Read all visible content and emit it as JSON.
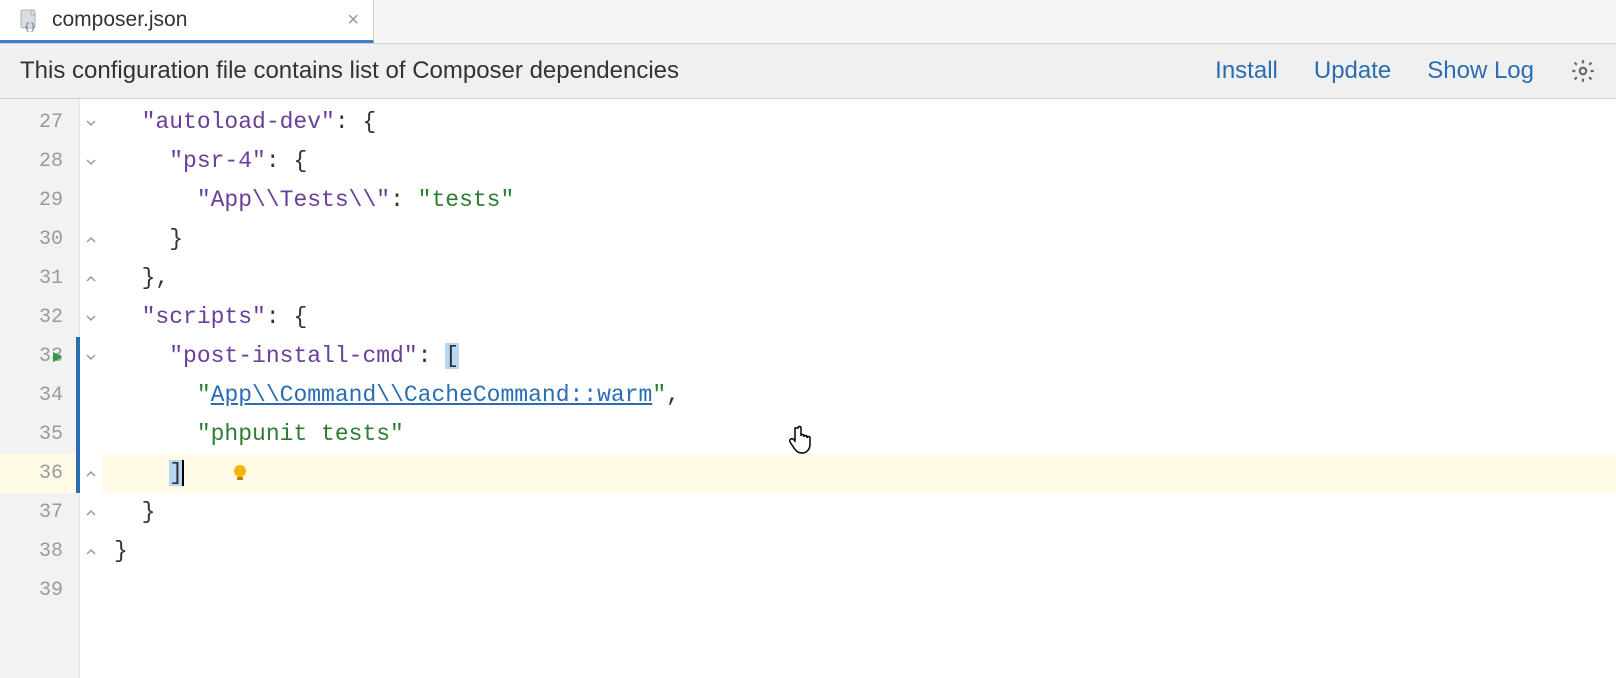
{
  "tab": {
    "title": "composer.json"
  },
  "notice": {
    "text": "This configuration file contains list of Composer dependencies",
    "install": "Install",
    "update": "Update",
    "showlog": "Show Log"
  },
  "lines": [
    {
      "num": 27,
      "tokens": [
        [
          "plain",
          "  "
        ],
        [
          "key",
          "\"autoload-dev\""
        ],
        [
          "punc",
          ": {"
        ]
      ]
    },
    {
      "num": 28,
      "tokens": [
        [
          "plain",
          "    "
        ],
        [
          "key",
          "\"psr-4\""
        ],
        [
          "punc",
          ": {"
        ]
      ]
    },
    {
      "num": 29,
      "tokens": [
        [
          "plain",
          "      "
        ],
        [
          "key",
          "\"App\\\\Tests\\\\\""
        ],
        [
          "punc",
          ": "
        ],
        [
          "str",
          "\"tests\""
        ]
      ]
    },
    {
      "num": 30,
      "tokens": [
        [
          "plain",
          "    "
        ],
        [
          "punc",
          "}"
        ]
      ]
    },
    {
      "num": 31,
      "tokens": [
        [
          "plain",
          "  "
        ],
        [
          "punc",
          "},"
        ]
      ]
    },
    {
      "num": 32,
      "tokens": [
        [
          "plain",
          "  "
        ],
        [
          "key",
          "\"scripts\""
        ],
        [
          "punc",
          ": {"
        ]
      ]
    },
    {
      "num": 33,
      "tokens": [
        [
          "plain",
          "    "
        ],
        [
          "key",
          "\"post-install-cmd\""
        ],
        [
          "punc",
          ": "
        ],
        [
          "sel",
          "["
        ]
      ],
      "run": true,
      "change": true
    },
    {
      "num": 34,
      "tokens": [
        [
          "plain",
          "      "
        ],
        [
          "str",
          "\""
        ],
        [
          "link",
          "App\\\\Command\\\\CacheCommand::warm"
        ],
        [
          "str",
          "\""
        ],
        [
          "punc",
          ","
        ]
      ],
      "change": true
    },
    {
      "num": 35,
      "tokens": [
        [
          "plain",
          "      "
        ],
        [
          "str",
          "\"phpunit tests\""
        ]
      ],
      "change": true
    },
    {
      "num": 36,
      "tokens": [
        [
          "plain",
          "    "
        ],
        [
          "sel",
          "]"
        ],
        [
          "caret",
          ""
        ]
      ],
      "current": true,
      "change": true,
      "bulb": true
    },
    {
      "num": 37,
      "tokens": [
        [
          "plain",
          "  "
        ],
        [
          "punc",
          "}"
        ]
      ]
    },
    {
      "num": 38,
      "tokens": [
        [
          "punc",
          "}"
        ]
      ]
    },
    {
      "num": 39,
      "tokens": []
    }
  ]
}
